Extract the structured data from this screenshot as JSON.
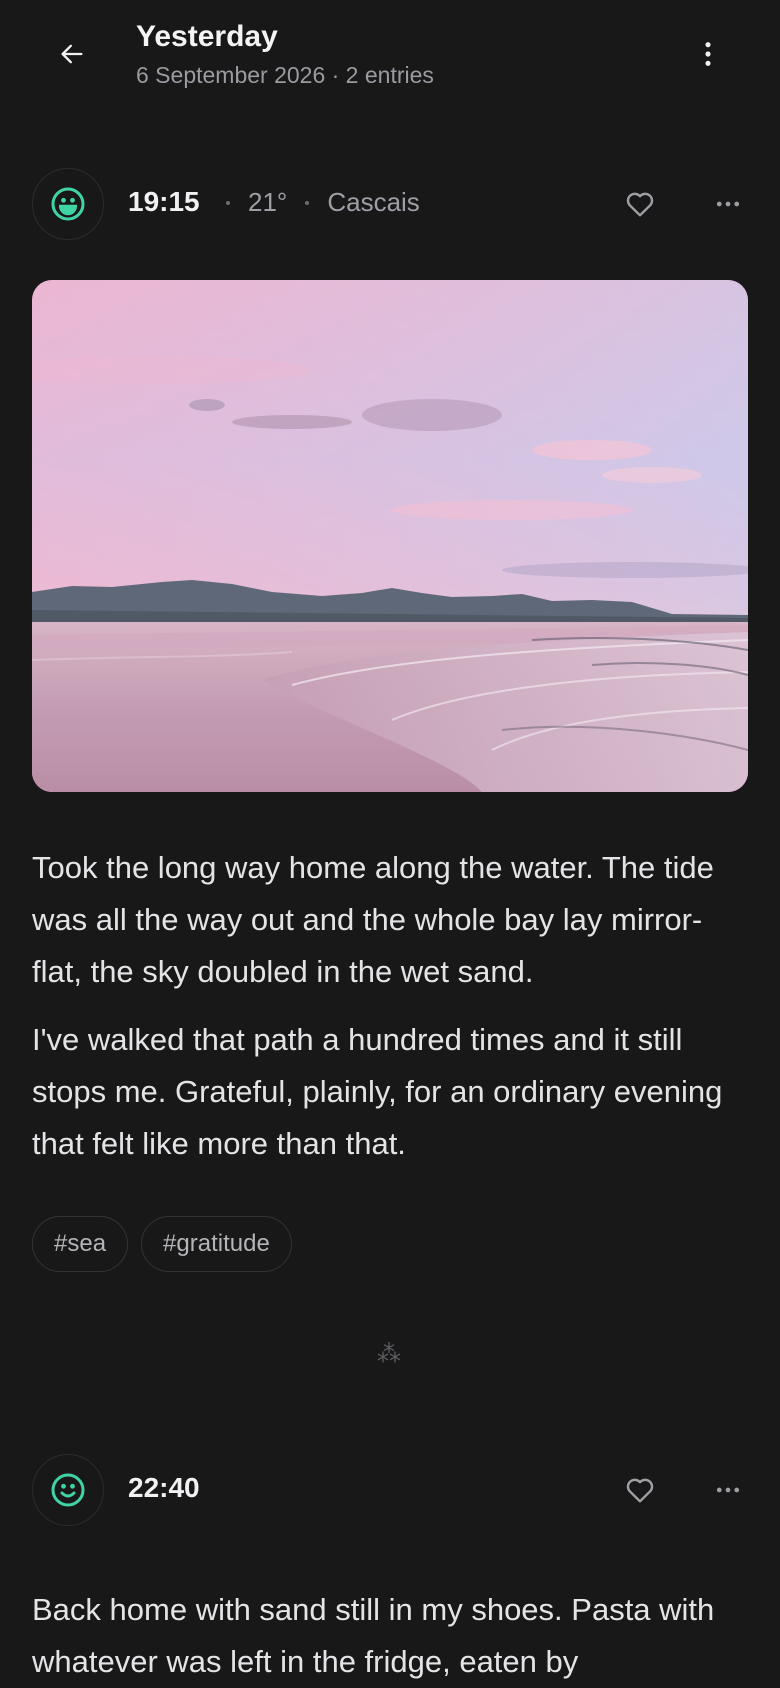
{
  "header": {
    "title": "Yesterday",
    "subtitle": "6 September 2026 · 2 entries",
    "back_icon": "arrow-left-icon",
    "menu_icon": "kebab-vertical-icon"
  },
  "colors": {
    "background": "#181819",
    "mood_accent": "#3fd3a5",
    "muted_text": "#9a9aa0"
  },
  "entries": [
    {
      "mood_icon": "smiley-icon",
      "time": "19:15",
      "temperature": "21°",
      "location": "Cascais",
      "favorite_icon": "heart-outline-icon",
      "more_icon": "more-horizontal-icon",
      "photo_icon": "beach-sunset-photo",
      "paragraphs": [
        "Took the long way home along the water. The tide was all the way out and the whole bay lay mirror-flat, the sky doubled in the wet sand.",
        "I've walked that path a hundred times and it still stops me. Grateful, plainly, for an ordinary evening that felt like more than that."
      ],
      "tags": [
        "#sea",
        "#gratitude"
      ]
    },
    {
      "mood_icon": "smiley-icon",
      "time": "22:40",
      "favorite_icon": "heart-outline-icon",
      "more_icon": "more-horizontal-icon",
      "paragraphs": [
        "Back home with sand still in my shoes. Pasta with whatever was left in the fridge, eaten by"
      ]
    }
  ],
  "divider": "⁂"
}
